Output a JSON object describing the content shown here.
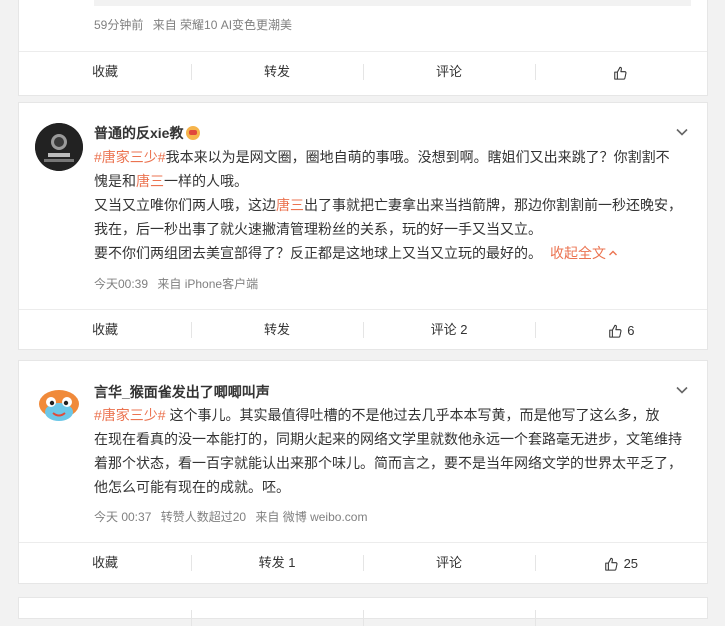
{
  "post0": {
    "meta": {
      "time": "59分钟前",
      "source": "来自 荣耀10 AI变色更潮美"
    },
    "actions": {
      "fav": "收藏",
      "repost": "转发",
      "comment": "评论",
      "like_count": ""
    }
  },
  "post1": {
    "user": "普通的反xie教",
    "lines": [
      {
        "topic": "#唐家三少#",
        "text1": "我本来以为是网文圈，圈地自萌的事哦。没想到啊。瞎姐们又出来跳了？你割割不",
        "hl": "",
        "text2": ""
      },
      {
        "topic": "",
        "text1": "愧是和",
        "hl": "唐三",
        "text2": "一样的人哦。"
      },
      {
        "topic": "",
        "text1": "又当又立唯你们两人哦，这边",
        "hl": "唐三",
        "text2": "出了事就把亡妻拿出来当挡箭牌，那边你割割前一秒还晚安，"
      },
      {
        "topic": "",
        "text1": "我在，后一秒出事了就火速撇清管理粉丝的关系，玩的好一手又当又立。",
        "hl": "",
        "text2": ""
      },
      {
        "topic": "",
        "text1": "要不你们两组团去美宣部得了？反正都是这地球上又当又立玩的最好的。",
        "hl": "",
        "text2": ""
      }
    ],
    "collapse": "收起全文",
    "meta": {
      "time": "今天00:39",
      "source": "来自 iPhone客户端"
    },
    "actions": {
      "fav": "收藏",
      "repost": "转发",
      "comment": "评论 2",
      "like_count": "6"
    }
  },
  "post2": {
    "user": "言华_猴面雀发出了唧唧叫声",
    "lines": [
      {
        "topic": "#唐家三少#",
        "text1": " 这个事儿。其实最值得吐槽的不是他过去几乎本本写黄，而是他写了这么多，放"
      },
      {
        "topic": "",
        "text1": "在现在看真的没一本能打的，同期火起来的网络文学里就数他永远一个套路毫无进步，文笔维持"
      },
      {
        "topic": "",
        "text1": "着那个状态，看一百字就能认出来那个味儿。简而言之，要不是当年网络文学的世界太平乏了，"
      },
      {
        "topic": "",
        "text1": "他怎么可能有现在的成就。呸。"
      }
    ],
    "meta": {
      "time": "今天 00:37",
      "reposts": "转赞人数超过20",
      "source": "来自 微博 weibo.com"
    },
    "actions": {
      "fav": "收藏",
      "repost": "转发 1",
      "comment": "评论",
      "like_count": "25"
    }
  }
}
